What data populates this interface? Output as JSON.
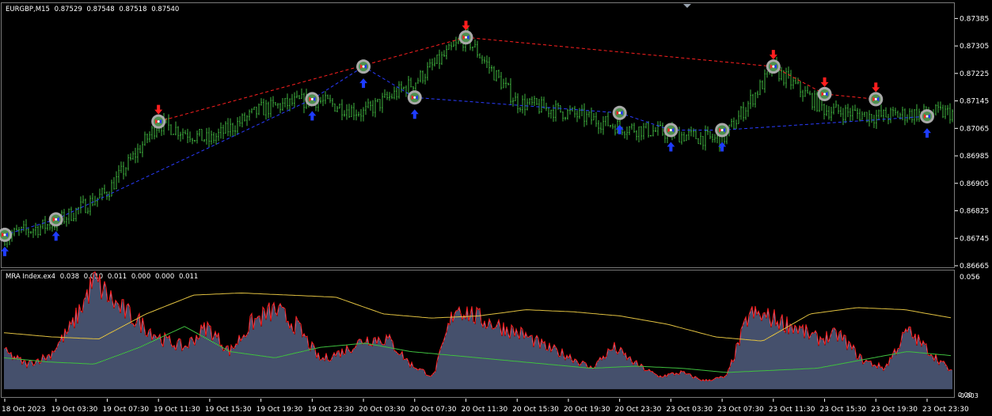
{
  "symbol_header": {
    "symbol": "EURGBP,M15",
    "ohlc": [
      "0.87529",
      "0.87548",
      "0.87518",
      "0.87540"
    ]
  },
  "indicator_header": {
    "name": "MRA Index.ex4",
    "values": [
      "0.038",
      "0.010",
      "0.011",
      "0.000",
      "0.000",
      "0.011"
    ]
  },
  "colors": {
    "background": "#000000",
    "border": "#7a7a7a",
    "candle": "#3fb43f",
    "buy_arrow": "#1e3cff",
    "sell_arrow": "#ff1e1e",
    "buy_line": "#2a3cff",
    "sell_line": "#ff2020",
    "histogram": "#8a9fd8",
    "hist_outline": "#ff2020",
    "slow_line": "#e0c040",
    "fast_line": "#3fbf3f"
  },
  "price_axis": {
    "labels": [
      "0.87385",
      "0.87305",
      "0.87225",
      "0.87145",
      "0.87065",
      "0.86985",
      "0.86905",
      "0.86825",
      "0.86745",
      "0.86665"
    ]
  },
  "indicator_axis": {
    "top": "0.056",
    "bottom_labels": [
      "0.00",
      "-0.003"
    ]
  },
  "time_axis": {
    "labels": [
      "18 Oct 2023",
      "19 Oct 03:30",
      "19 Oct 07:30",
      "19 Oct 11:30",
      "19 Oct 15:30",
      "19 Oct 19:30",
      "19 Oct 23:30",
      "20 Oct 03:30",
      "20 Oct 07:30",
      "20 Oct 11:30",
      "20 Oct 15:30",
      "20 Oct 19:30",
      "20 Oct 23:30",
      "23 Oct 03:30",
      "23 Oct 07:30",
      "23 Oct 11:30",
      "23 Oct 15:30",
      "23 Oct 19:30",
      "23 Oct 23:30"
    ]
  },
  "chart_data": {
    "type": "candlestick",
    "symbol": "EURGBP",
    "timeframe": "M15",
    "x_range": [
      "18 Oct 2023",
      "24 Oct 2023"
    ],
    "ylim": [
      0.86665,
      0.87425
    ],
    "close_path": [
      {
        "t": "18 Oct 2023",
        "close": 0.8675
      },
      {
        "t": "19 Oct 03:30",
        "close": 0.8679
      },
      {
        "t": "19 Oct 07:30",
        "close": 0.8688
      },
      {
        "t": "19 Oct 11:30",
        "close": 0.8708
      },
      {
        "t": "19 Oct 15:30",
        "close": 0.8703
      },
      {
        "t": "19 Oct 19:30",
        "close": 0.8712
      },
      {
        "t": "19 Oct 23:30",
        "close": 0.8715
      },
      {
        "t": "20 Oct 03:30",
        "close": 0.8711
      },
      {
        "t": "20 Oct 07:30",
        "close": 0.872
      },
      {
        "t": "20 Oct 11:30",
        "close": 0.8733
      },
      {
        "t": "20 Oct 15:30",
        "close": 0.8714
      },
      {
        "t": "20 Oct 19:30",
        "close": 0.8711
      },
      {
        "t": "20 Oct 23:30",
        "close": 0.8707
      },
      {
        "t": "23 Oct 03:30",
        "close": 0.8705
      },
      {
        "t": "23 Oct 07:30",
        "close": 0.8703
      },
      {
        "t": "23 Oct 11:30",
        "close": 0.8724
      },
      {
        "t": "23 Oct 15:30",
        "close": 0.8712
      },
      {
        "t": "23 Oct 19:30",
        "close": 0.871
      },
      {
        "t": "23 Oct 23:30",
        "close": 0.8711
      }
    ],
    "buy_signals": [
      {
        "t": "18 Oct 2023",
        "price": 0.86755
      },
      {
        "t": "19 Oct 03:30",
        "price": 0.868
      },
      {
        "t": "19 Oct 23:30",
        "price": 0.8715
      },
      {
        "t": "20 Oct 03:30",
        "price": 0.87245
      },
      {
        "t": "20 Oct 07:30",
        "price": 0.87155
      },
      {
        "t": "20 Oct 23:30",
        "price": 0.8711
      },
      {
        "t": "23 Oct 03:30",
        "price": 0.8706
      },
      {
        "t": "23 Oct 07:30",
        "price": 0.8706
      },
      {
        "t": "23 Oct 23:30",
        "price": 0.871
      }
    ],
    "sell_signals": [
      {
        "t": "19 Oct 11:30",
        "price": 0.87085
      },
      {
        "t": "20 Oct 11:30",
        "price": 0.8733
      },
      {
        "t": "23 Oct 11:30",
        "price": 0.87245
      },
      {
        "t": "23 Oct 15:30",
        "price": 0.87165
      },
      {
        "t": "23 Oct 19:30",
        "price": 0.8715
      }
    ],
    "indicator": {
      "name": "MRA Index",
      "ylim": [
        -0.003,
        0.056
      ],
      "histogram_profile": [
        0.018,
        0.012,
        0.016,
        0.03,
        0.052,
        0.04,
        0.032,
        0.024,
        0.02,
        0.03,
        0.018,
        0.032,
        0.038,
        0.03,
        0.014,
        0.018,
        0.024,
        0.024,
        0.012,
        0.006,
        0.04,
        0.034,
        0.03,
        0.026,
        0.02,
        0.016,
        0.01,
        0.02,
        0.012,
        0.006,
        0.008,
        0.004,
        0.006,
        0.036,
        0.034,
        0.03,
        0.024,
        0.026,
        0.014,
        0.01,
        0.028,
        0.018,
        0.008
      ],
      "slow_line_profile": [
        0.027,
        0.025,
        0.024,
        0.036,
        0.045,
        0.046,
        0.045,
        0.044,
        0.036,
        0.034,
        0.035,
        0.038,
        0.037,
        0.035,
        0.031,
        0.025,
        0.023,
        0.036,
        0.039,
        0.038,
        0.034
      ],
      "fast_line_profile": [
        0.015,
        0.013,
        0.012,
        0.02,
        0.03,
        0.018,
        0.015,
        0.02,
        0.022,
        0.018,
        0.016,
        0.014,
        0.012,
        0.01,
        0.011,
        0.01,
        0.008,
        0.009,
        0.01,
        0.014,
        0.018,
        0.016
      ]
    }
  }
}
